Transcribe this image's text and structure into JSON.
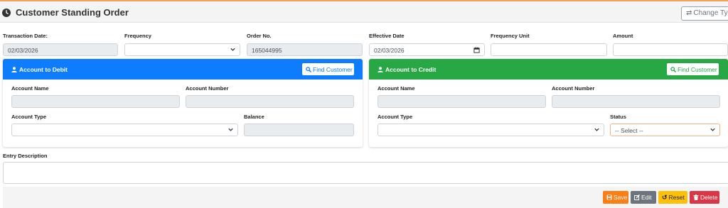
{
  "header": {
    "title": "Customer Standing Order",
    "change_type_label": "Change Type"
  },
  "form": {
    "transaction_date": {
      "label": "Transaction Date:",
      "value": "02/03/2026"
    },
    "frequency": {
      "label": "Frequency",
      "value": ""
    },
    "order_no": {
      "label": "Order No.",
      "value": "165044995"
    },
    "effective_date": {
      "label": "Effective Date",
      "value": "02/03/2026"
    },
    "frequency_unit": {
      "label": "Frequency Unit",
      "value": ""
    },
    "amount": {
      "label": "Amount",
      "value": ""
    }
  },
  "debit": {
    "title": "Account to Debit",
    "find_label": "Find Customer",
    "account_name_label": "Account Name",
    "account_number_label": "Account Number",
    "account_type_label": "Account Type",
    "balance_label": "Balance",
    "account_name": "",
    "account_number": "",
    "account_type": "",
    "balance": ""
  },
  "credit": {
    "title": "Account to Credit",
    "find_label": "Find Customer",
    "account_name_label": "Account Name",
    "account_number_label": "Account Number",
    "account_type_label": "Account Type",
    "status_label": "Status",
    "account_name": "",
    "account_number": "",
    "account_type": "",
    "status_value": "-- Select --"
  },
  "entry_description": {
    "label": "Entry Description",
    "value": ""
  },
  "actions": {
    "save": "Save",
    "edit": "Edit",
    "reset": "Reset",
    "delete": "Delete"
  },
  "colors": {
    "debit_header": "#0d7cff",
    "credit_header": "#28a745",
    "save": "#fd7e14",
    "edit": "#6c757d",
    "reset": "#ffc107",
    "delete": "#dc3545"
  },
  "icons": [
    "clock-icon",
    "exchange-icon",
    "chevron-down-icon",
    "calendar-icon",
    "user-icon",
    "search-icon",
    "save-icon",
    "edit-icon",
    "undo-icon",
    "trash-icon"
  ]
}
